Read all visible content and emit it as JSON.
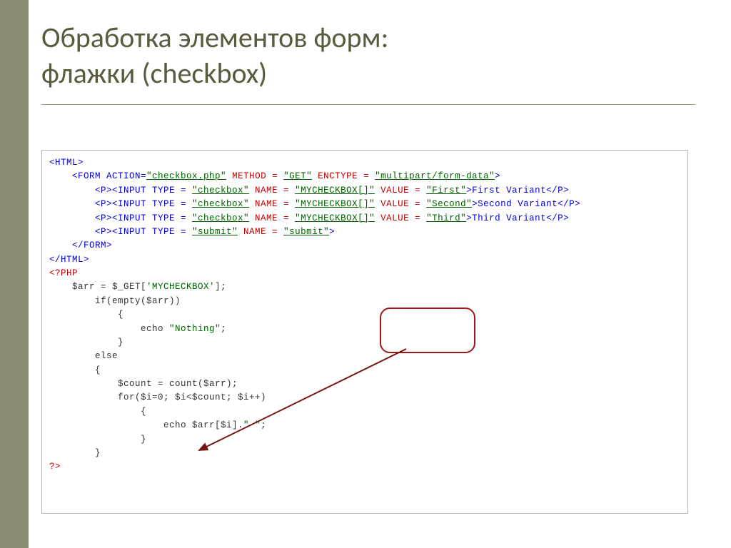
{
  "title_line1": "Обработка элементов форм:",
  "title_line2": "флажки (checkbox)",
  "code": {
    "l1": "<HTML>",
    "l2a": "    <FORM ACTION=",
    "l2b": "\"checkbox.php\"",
    "l2c": " METHOD = ",
    "l2d": "\"GET\"",
    "l2e": " ENCTYPE = ",
    "l2f": "\"multipart/form-data\"",
    "l2g": ">",
    "l3a": "        <P><INPUT TYPE = ",
    "l3b": "\"checkbox\"",
    "l3c": " NAME = ",
    "l3d": "\"MYCHECKBOX[]\"",
    "l3e": " VALUE = ",
    "l3f": "\"First\"",
    "l3g": ">First Variant</P>",
    "l4f": "\"Second\"",
    "l4g": ">Second Variant</P>",
    "l5f": "\"Third\"",
    "l5g": ">Third Variant</P>",
    "l6a": "        <P><INPUT TYPE = ",
    "l6b": "\"submit\"",
    "l6c": " NAME = ",
    "l6d": "\"submit\"",
    "l6e": ">",
    "l7": "    </FORM>",
    "l8": "</HTML>",
    "l9": "<?PHP",
    "l10a": "    $arr = $_GET[",
    "l10b": "'MYCHECKBOX'",
    "l10c": "];",
    "l11": "        if(empty($arr))",
    "l12": "            {",
    "l13a": "                echo ",
    "l13b": "\"Nothing\"",
    "l13c": ";",
    "l14": "            }",
    "l15": "        else",
    "l16": "        {",
    "l17": "            $count = count($arr);",
    "l18": "            for($i=0; $i<$count; $i++)",
    "l19": "                {",
    "l20a": "                    echo $arr[$i].",
    "l20b": "\" \"",
    "l20c": ";",
    "l21": "                }",
    "l22": "        }",
    "l23": "?>"
  }
}
